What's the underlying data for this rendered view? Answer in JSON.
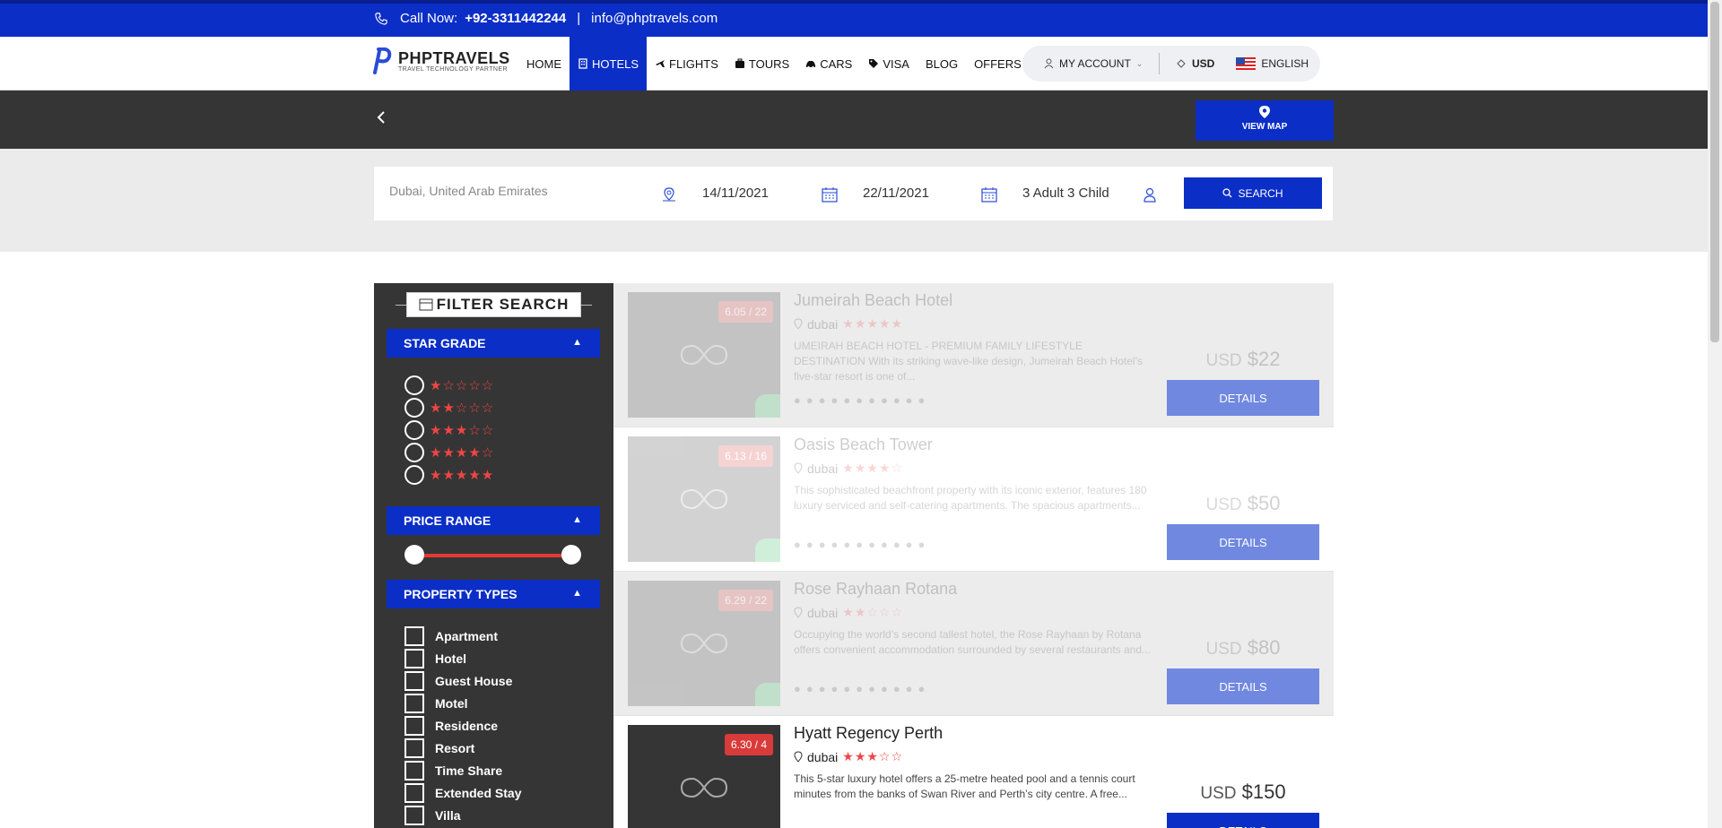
{
  "topbar": {
    "call_label": "Call Now:",
    "phone": "+92-3311442244",
    "separator": "|",
    "email": "info@phptravels.com"
  },
  "logo": {
    "brand": "PHPTRAVELS",
    "tagline": "TRAVEL TECHNOLOGY PARTNER"
  },
  "nav": {
    "home": "HOME",
    "hotels": "HOTELS",
    "flights": "FLIGHTS",
    "tours": "TOURS",
    "cars": "CARS",
    "visa": "VISA",
    "blog": "BLOG",
    "offers": "OFFERS",
    "account": "MY ACCOUNT",
    "currency": "USD",
    "language": "ENGLISH"
  },
  "map_button": "VIEW MAP",
  "search": {
    "location": "Dubai, United Arab Emirates",
    "checkin": "14/11/2021",
    "checkout": "22/11/2021",
    "guests": "3 Adult 3 Child",
    "button": "SEARCH"
  },
  "filters": {
    "title": "FILTER SEARCH",
    "star_grade": "STAR GRADE",
    "price_range": "PRICE RANGE",
    "price_slider": {
      "min_fraction": 0,
      "max_fraction": 1
    },
    "property_types_title": "PROPERTY TYPES",
    "property_types": [
      "Apartment",
      "Hotel",
      "Guest House",
      "Motel",
      "Residence",
      "Resort",
      "Time Share",
      "Extended Stay",
      "Villa"
    ],
    "star_options": [
      "★☆☆☆☆",
      "★★☆☆☆",
      "★★★☆☆",
      "★★★★☆",
      "★★★★★"
    ]
  },
  "hotels": [
    {
      "name": "Jumeirah Beach Hotel",
      "rating": "6.05 / 22",
      "location": "dubai",
      "stars": "★★★★★",
      "desc": "UMEIRAH BEACH HOTEL - PREMIUM FAMILY LIFESTYLE DESTINATION With its striking wave-like design, Jumeirah Beach Hotel's five-star resort is one of...",
      "currency": "USD",
      "price": "$22",
      "button": "DETAILS"
    },
    {
      "name": "Oasis Beach Tower",
      "rating": "6.13 / 16",
      "location": "dubai",
      "stars": "★★★★☆",
      "desc": "This sophisticated beachfront property with its iconic exterior, features 180 luxury serviced and self-catering apartments. The spacious apartments...",
      "currency": "USD",
      "price": "$50",
      "button": "DETAILS"
    },
    {
      "name": "Rose Rayhaan Rotana",
      "rating": "6.29 / 22",
      "location": "dubai",
      "stars": "★★☆☆☆",
      "desc": "Occupying the world’s second tallest hotel, the Rose Rayhaan by Rotana offers convenient accommodation surrounded by several restaurants and...",
      "currency": "USD",
      "price": "$80",
      "button": "DETAILS"
    },
    {
      "name": "Hyatt Regency Perth",
      "rating": "6.30 / 4",
      "location": "dubai",
      "stars": "★★★☆☆",
      "desc": "This 5-star luxury hotel offers a 25-metre heated pool and a tennis court minutes from the banks of Swan River and Perth’s city centre. A free...",
      "currency": "USD",
      "price": "$150",
      "button": "DETAILS"
    }
  ],
  "colors": {
    "primary": "#0b2ec7",
    "dark": "#353535",
    "star": "#f04545",
    "badge": "#d93a3a",
    "wishlist": "#2eb85c"
  }
}
